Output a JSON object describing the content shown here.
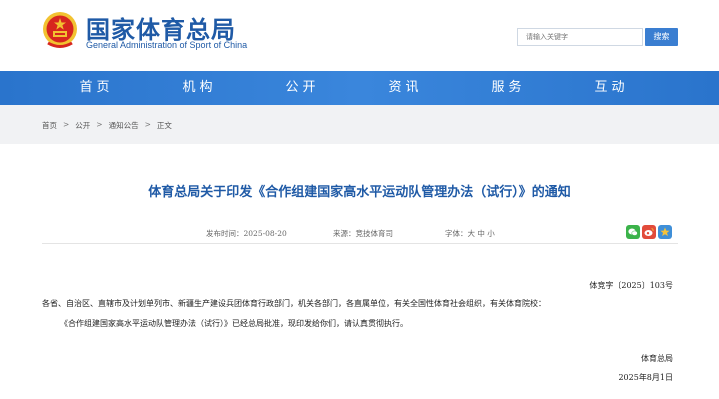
{
  "header": {
    "site_title": "国家体育总局",
    "site_subtitle": "General Administration of Sport of China",
    "search_placeholder": "请输入关键字",
    "search_button": "搜索"
  },
  "nav": {
    "items": [
      "首页",
      "机构",
      "公开",
      "资讯",
      "服务",
      "互动"
    ]
  },
  "breadcrumb": {
    "items": [
      "首页",
      "公开",
      "通知公告",
      "正文"
    ],
    "separator": ">"
  },
  "article": {
    "title": "体育总局关于印发《合作组建国家高水平运动队管理办法（试行）》的通知",
    "publish_time": "发布时间：2025-08-20",
    "source": "来源：竞技体育司",
    "font_size": "字体：大 中 小",
    "doc_number": "体竞字〔2025〕103号",
    "addressee": "各省、自治区、直辖市及计划单列市、新疆生产建设兵团体育行政部门，机关各部门，各直属单位，有关全国性体育社会组织，有关体育院校：",
    "body": "《合作组建国家高水平运动队管理办法（试行）》已经总局批准，现印发给你们，请认真贯彻执行。",
    "signer": "体育总局",
    "sign_date": "2025年8月1日"
  },
  "colors": {
    "brand_blue": "#1f5aa6",
    "nav_blue": "#3a86dc",
    "emblem_red": "#d7261e",
    "emblem_gold": "#f2c230"
  },
  "icons": [
    "national-emblem-icon",
    "wechat-icon",
    "weibo-icon",
    "qzone-icon"
  ]
}
